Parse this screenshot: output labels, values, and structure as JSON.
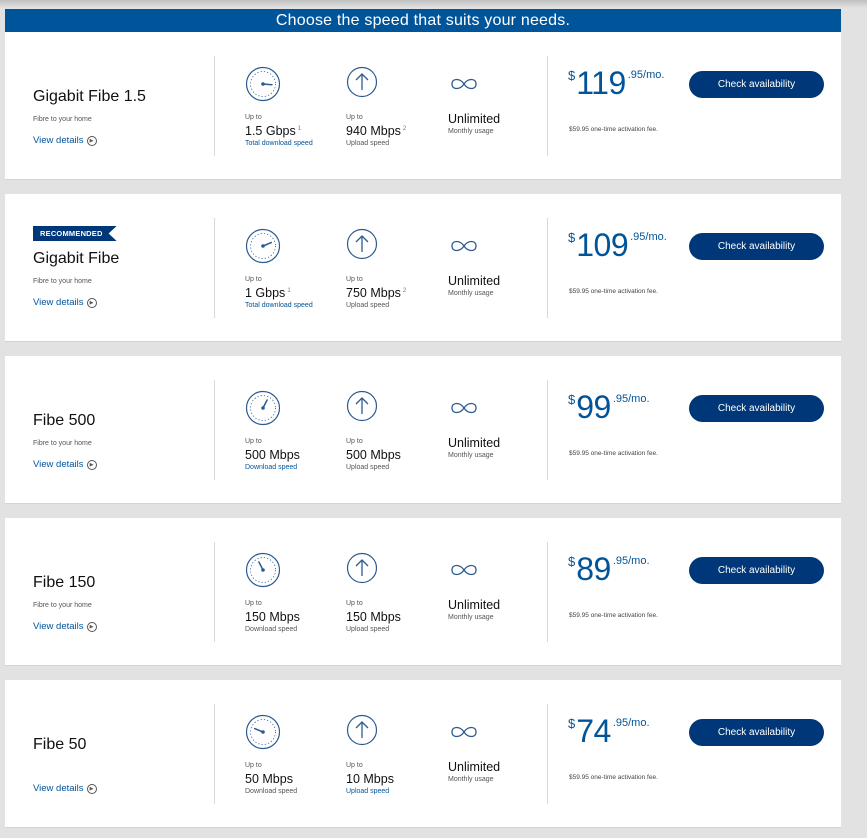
{
  "banner": "Choose the speed that suits your needs.",
  "plans": [
    {
      "badge": "",
      "name": "Gigabit Fibe 1.5",
      "subtitle": "Fibre to your home",
      "details_label": "View details",
      "download": {
        "up_to": "Up to",
        "value": "1.5 Gbps",
        "footnote": "1",
        "label": "Total download speed",
        "label_is_link": true,
        "gauge_level": 0.85
      },
      "upload": {
        "up_to": "Up to",
        "value": "940 Mbps",
        "footnote": "2",
        "label": "Upload speed",
        "label_is_link": false
      },
      "usage": {
        "value": "Unlimited",
        "label": "Monthly usage"
      },
      "price": {
        "currency": "$",
        "dollars": "119",
        "cents": ".95/mo."
      },
      "activation": "$59.95 one-time activation fee.",
      "button_label": "Check availability"
    },
    {
      "badge": "RECOMMENDED",
      "name": "Gigabit Fibe",
      "subtitle": "Fibre to your home",
      "details_label": "View details",
      "download": {
        "up_to": "Up to",
        "value": "1 Gbps",
        "footnote": "1",
        "label": "Total download speed",
        "label_is_link": true,
        "gauge_level": 0.75
      },
      "upload": {
        "up_to": "Up to",
        "value": "750 Mbps",
        "footnote": "2",
        "label": "Upload speed",
        "label_is_link": false
      },
      "usage": {
        "value": "Unlimited",
        "label": "Monthly usage"
      },
      "price": {
        "currency": "$",
        "dollars": "109",
        "cents": ".95/mo."
      },
      "activation": "$59.95 one-time activation fee.",
      "button_label": "Check availability"
    },
    {
      "badge": "",
      "name": "Fibe 500",
      "subtitle": "Fibre to your home",
      "details_label": "View details",
      "download": {
        "up_to": "Up to",
        "value": "500 Mbps",
        "footnote": "",
        "label": "Download speed",
        "label_is_link": true,
        "gauge_level": 0.6
      },
      "upload": {
        "up_to": "Up to",
        "value": "500 Mbps",
        "footnote": "",
        "label": "Upload speed",
        "label_is_link": false
      },
      "usage": {
        "value": "Unlimited",
        "label": "Monthly usage"
      },
      "price": {
        "currency": "$",
        "dollars": "99",
        "cents": ".95/mo."
      },
      "activation": "$59.95 one-time activation fee.",
      "button_label": "Check availability"
    },
    {
      "badge": "",
      "name": "Fibe 150",
      "subtitle": "Fibre to your home",
      "details_label": "View details",
      "download": {
        "up_to": "Up to",
        "value": "150 Mbps",
        "footnote": "",
        "label": "Download speed",
        "label_is_link": false,
        "gauge_level": 0.4
      },
      "upload": {
        "up_to": "Up to",
        "value": "150 Mbps",
        "footnote": "",
        "label": "Upload speed",
        "label_is_link": false
      },
      "usage": {
        "value": "Unlimited",
        "label": "Monthly usage"
      },
      "price": {
        "currency": "$",
        "dollars": "89",
        "cents": ".95/mo."
      },
      "activation": "$59.95 one-time activation fee.",
      "button_label": "Check availability"
    },
    {
      "badge": "",
      "name": "Fibe 50",
      "subtitle": "",
      "details_label": "View details",
      "download": {
        "up_to": "Up to",
        "value": "50 Mbps",
        "footnote": "",
        "label": "Download speed",
        "label_is_link": false,
        "gauge_level": 0.25
      },
      "upload": {
        "up_to": "Up to",
        "value": "10 Mbps",
        "footnote": "",
        "label": "Upload speed",
        "label_is_link": true
      },
      "usage": {
        "value": "Unlimited",
        "label": "Monthly usage"
      },
      "price": {
        "currency": "$",
        "dollars": "74",
        "cents": ".95/mo."
      },
      "activation": "$59.95 one-time activation fee.",
      "button_label": "Check availability"
    }
  ],
  "colors": {
    "brand_blue": "#00549a",
    "button_navy": "#003778",
    "icon_blue": "#2d5b8f"
  },
  "icons": {
    "download": "speedometer-icon",
    "upload": "arrow-up-circle-icon",
    "usage": "infinity-icon",
    "details": "play-circle-icon"
  }
}
